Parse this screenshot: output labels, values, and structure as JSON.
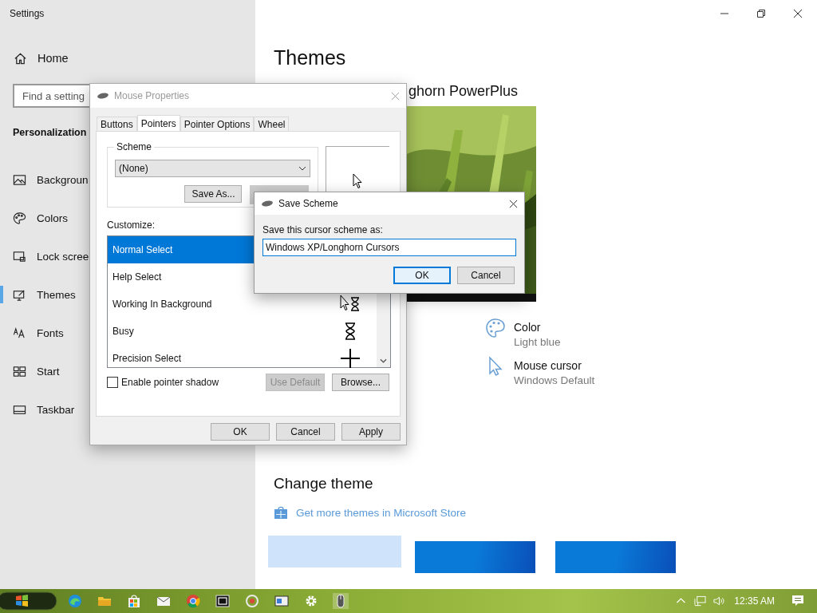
{
  "settings": {
    "title": "Settings",
    "home": "Home",
    "search": {
      "placeholder": "Find a setting"
    },
    "section": "Personalization",
    "nav": [
      {
        "label": "Backgroun",
        "selected": false
      },
      {
        "label": "Colors",
        "selected": false
      },
      {
        "label": "Lock scree",
        "selected": false
      },
      {
        "label": "Themes",
        "selected": true
      },
      {
        "label": "Fonts",
        "selected": false
      },
      {
        "label": "Start",
        "selected": false
      },
      {
        "label": "Taskbar",
        "selected": false
      }
    ]
  },
  "themes_page": {
    "title": "Themes",
    "current_theme": "ghorn PowerPlus",
    "items": [
      {
        "label": "Color",
        "value": "Light blue"
      },
      {
        "label": "Mouse cursor",
        "value": "Windows Default"
      }
    ],
    "change_theme": "Change theme",
    "store_link": "Get more themes in Microsoft Store",
    "thumbnails": [
      {
        "color": "#cfe4fa"
      },
      {
        "color": "#0a7ad8"
      },
      {
        "color": "#0a7ad8"
      }
    ]
  },
  "mouse_properties": {
    "title": "Mouse Properties",
    "tabs": [
      {
        "label": "Buttons",
        "selected": false
      },
      {
        "label": "Pointers",
        "selected": true
      },
      {
        "label": "Pointer Options",
        "selected": false
      },
      {
        "label": "Wheel",
        "selected": false
      }
    ],
    "scheme_label": "Scheme",
    "scheme_value": "(None)",
    "save_as": "Save As...",
    "customize_label": "Customize:",
    "pointers": [
      {
        "name": "Normal Select",
        "selected": true
      },
      {
        "name": "Help Select",
        "selected": false
      },
      {
        "name": "Working In Background",
        "selected": false
      },
      {
        "name": "Busy",
        "selected": false
      },
      {
        "name": "Precision Select",
        "selected": false
      }
    ],
    "shadow": {
      "label": "Enable pointer shadow",
      "checked": false
    },
    "use_default": {
      "label": "Use Default",
      "disabled": true
    },
    "browse": {
      "label": "Browse...",
      "disabled": false
    },
    "buttons": [
      {
        "label": "OK"
      },
      {
        "label": "Cancel"
      },
      {
        "label": "Apply"
      }
    ]
  },
  "save_scheme": {
    "title": "Save Scheme",
    "prompt": "Save this cursor scheme as:",
    "value": "Windows XP/Longhorn Cursors",
    "buttons": [
      {
        "label": "OK",
        "default": true
      },
      {
        "label": "Cancel",
        "default": false
      }
    ]
  },
  "taskbar": {
    "clock": "12:35 AM"
  }
}
